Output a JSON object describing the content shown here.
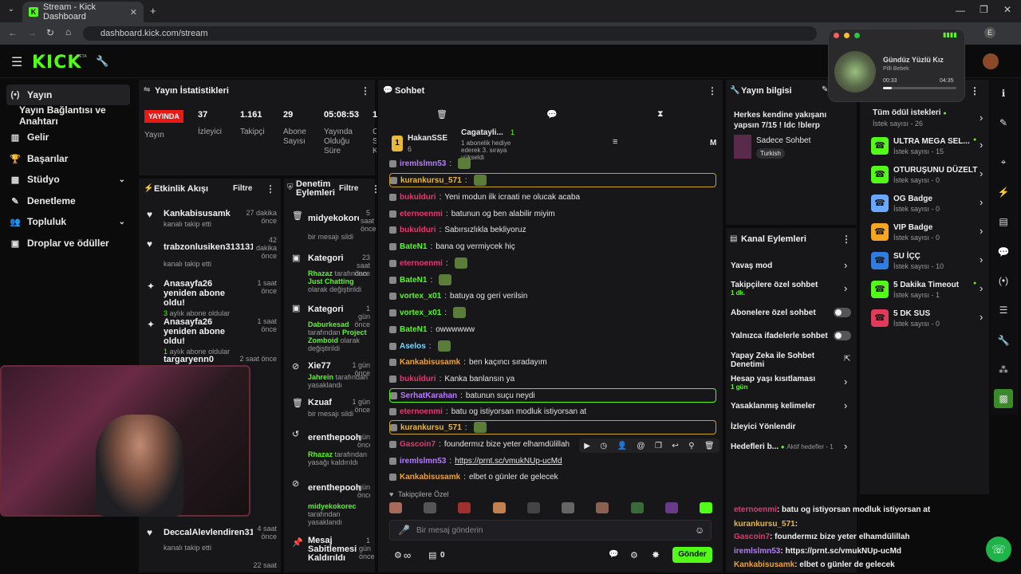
{
  "browser": {
    "tab_title": "Stream - Kick Dashboard",
    "url": "dashboard.kick.com/stream",
    "profile_initial": "E"
  },
  "header": {
    "logo": "KICK",
    "logo_tag": "BETA"
  },
  "sidebar": {
    "items": [
      {
        "label": "Yayın",
        "icon": "(•)"
      },
      {
        "label": "Yayın Bağlantısı ve Anahtarı",
        "icon": ""
      },
      {
        "label": "Gelir",
        "icon": "▥"
      },
      {
        "label": "Başarılar",
        "icon": "🏆"
      },
      {
        "label": "Stüdyo",
        "icon": "▦"
      },
      {
        "label": "Denetleme",
        "icon": "✎"
      },
      {
        "label": "Topluluk",
        "icon": "👥"
      },
      {
        "label": "Droplar ve ödüller",
        "icon": "▣"
      }
    ]
  },
  "stats": {
    "title": "Yayın İstatistikleri",
    "live_badge": "YAYINDA",
    "live_label": "Yayın",
    "items": [
      {
        "value": "37",
        "label": "İzleyici"
      },
      {
        "value": "1.161",
        "label": "Takipçi"
      },
      {
        "value": "29",
        "label": "Abone Sayısı"
      },
      {
        "value": "05:08:53",
        "label": "Yayında Olduğu Süre"
      },
      {
        "value": "1",
        "label": "C S K"
      }
    ]
  },
  "activity": {
    "title": "Etkinlik Akışı",
    "filter": "Filtre",
    "items": [
      {
        "title": "Kankabisusamk",
        "sub": "kanalı takip etti",
        "time": "27 dakika önce"
      },
      {
        "title": "trabzonlusiken313131314",
        "sub": "kanalı takip etti",
        "time": "42 dakika önce"
      },
      {
        "title": "Anasayfa26 yeniden abone oldu!",
        "sub": "aylık abone oldular",
        "subnum": "3",
        "time": "1 saat önce"
      },
      {
        "title": "Anasayfa26 yeniden abone oldu!",
        "sub": "aylık abone oldular",
        "subnum": "1",
        "time": "1 saat önce"
      },
      {
        "title": "targaryenn0",
        "sub": "",
        "time": "2 saat önce"
      },
      {
        "title": "DeccalAlevlendiren3131",
        "sub": "kanalı takip etti",
        "time": "4 saat önce"
      },
      {
        "title": "",
        "sub": "",
        "time": "22 saat"
      }
    ]
  },
  "modlog": {
    "title": "Denetim Eylemleri",
    "filter": "Filtre",
    "items": [
      {
        "title": "midyekokorec",
        "sub": "bir mesajı sildi",
        "time": "5 saat önce"
      },
      {
        "title": "Kategori",
        "sub_user": "Rhazaz",
        "sub": "tarafından",
        "sub_hl": "Just Chatting",
        "sub2": "olarak değiştirildi",
        "time": "23 saat önce"
      },
      {
        "title": "Kategori",
        "sub_user": "Daburkesad",
        "sub": "tarafından",
        "sub_hl": "Project Zomboid",
        "sub2": "olarak değiştirildi",
        "time": "1 gün önce"
      },
      {
        "title": "Xie77",
        "sub_user": "Jahrein",
        "sub": "tarafından yasaklandı",
        "time": "1 gün önce"
      },
      {
        "title": "Kzuaf",
        "sub": "bir mesajı sildi",
        "time": "1 gün önce"
      },
      {
        "title": "erenthepooh",
        "sub_user": "Rhazaz",
        "sub": "tarafından yasağı kaldırıldı",
        "time": "gün önce"
      },
      {
        "title": "erenthepooh",
        "sub_user": "midyekokorec",
        "sub": "tarafından yasaklandı",
        "time": "gün önce"
      },
      {
        "title": "Mesaj Sabitlemesi Kaldırıldı",
        "sub": "",
        "time": "1 gün önce"
      }
    ]
  },
  "chat": {
    "title": "Sohbet",
    "gifter1": {
      "name": "HakanSSE",
      "count": "6"
    },
    "gifter2": {
      "name": "Cagatayli...",
      "count": "1",
      "text": "1 abonelik hediye ederek 3. sıraya yükseldi"
    },
    "messages": [
      {
        "user": "iremlslmn53",
        "text": "",
        "color": "#b57bff"
      },
      {
        "user": "kurankursu_571",
        "text": "",
        "color": "#e8b93c",
        "highlight": "gold"
      },
      {
        "user": "bukulduri",
        "text": "Yeni modun ilk icraati ne olucak acaba",
        "color": "#e3386e"
      },
      {
        "user": "eternoenmi",
        "text": "batunun og ben alabilir miyim",
        "color": "#e3386e"
      },
      {
        "user": "bukulduri",
        "text": "Sabırsızlıkla bekliyoruz",
        "color": "#e3386e"
      },
      {
        "user": "BateN1",
        "text": "bana og vermiycek hiç",
        "color": "#53fc18"
      },
      {
        "user": "eternoenmi",
        "text": "",
        "color": "#e3386e"
      },
      {
        "user": "BateN1",
        "text": "",
        "color": "#53fc18"
      },
      {
        "user": "vortex_x01",
        "text": "batuya og geri verilsin",
        "color": "#53fc18"
      },
      {
        "user": "vortex_x01",
        "text": "",
        "color": "#53fc18"
      },
      {
        "user": "BateN1",
        "text": "owwwwww",
        "color": "#53fc18"
      },
      {
        "user": "Aselos",
        "text": "",
        "color": "#7ad7ff"
      },
      {
        "user": "Kankabisusamk",
        "text": "ben kaçıncı sıradayım",
        "color": "#e8a33c"
      },
      {
        "user": "bukulduri",
        "text": "Kanka banlansın ya",
        "color": "#e3386e"
      },
      {
        "user": "SerhatKarahan",
        "text": "batunun suçu neydi",
        "color": "#b57bff",
        "highlight": "green"
      },
      {
        "user": "eternoenmi",
        "text": "batu og istiyorsan  modluk istiyorsan  at",
        "color": "#e3386e"
      },
      {
        "user": "kurankursu_571",
        "text": "",
        "color": "#e8b93c",
        "highlight": "gold"
      },
      {
        "user": "Gascoin7",
        "text": "foundermız bize yeter elhamdülillah",
        "color": "#e3386e"
      },
      {
        "user": "iremlslmn53",
        "text": "https://prnt.sc/vmukNUp-ucMd",
        "color": "#b57bff"
      },
      {
        "user": "Kankabisusamk",
        "text": "elbet o günler de gelecek",
        "color": "#e8a33c"
      }
    ],
    "followers_only": "Takipçilere Özel",
    "input_placeholder": "Bir mesaj gönderin",
    "count": "0",
    "send": "Gönder",
    "infinity": "∞"
  },
  "streaminfo": {
    "title": "Yayın bilgisi",
    "stream_title": "Herkes kendine yakışanı yapsın 7/15 ! Idc !blerp",
    "category": "Sadece Sohbet",
    "tag": "Turkish"
  },
  "channel_actions": {
    "title": "Kanal Eylemleri",
    "items": [
      {
        "label": "Yavaş mod",
        "type": "chevron"
      },
      {
        "label": "Takipçilere özel sohbet",
        "sub": "1 dk.",
        "type": "chevron"
      },
      {
        "label": "Abonelere özel sohbet",
        "type": "toggle"
      },
      {
        "label": "Yalnızca ifadelerle sohbet",
        "type": "toggle"
      },
      {
        "label": "Yapay Zeka ile Sohbet Denetimi",
        "type": "external"
      },
      {
        "label": "Hesap yaşı kısıtlaması",
        "sub": "1 gün",
        "type": "chevron"
      },
      {
        "label": "Yasaklanmış kelimeler",
        "type": "chevron"
      },
      {
        "label": "İzleyici Yönlendir",
        "type": "none"
      },
      {
        "label": "Hedefleri b...",
        "extra": "Aktif hedefler - 1",
        "type": "chevron"
      }
    ]
  },
  "rewards": {
    "all": "Tüm ödül istekleri",
    "all_count": "İstek sayısı - 26",
    "items": [
      {
        "name": "ULTRA MEGA SEL...",
        "count": "İstek sayısı - 15",
        "color": "#53fc18",
        "dot": true
      },
      {
        "name": "OTURUŞUNU DÜZELT",
        "count": "İstek sayısı - 0",
        "color": "#53fc18",
        "dot": false
      },
      {
        "name": "OG Badge",
        "count": "İstek sayısı - 0",
        "color": "#6aa7ff",
        "dot": false
      },
      {
        "name": "VIP Badge",
        "count": "İstek sayısı - 0",
        "color": "#f5a623",
        "dot": false
      },
      {
        "name": "SU İÇÇ",
        "count": "İstek sayısı - 10",
        "color": "#2f7de1",
        "dot": false
      },
      {
        "name": "5 Dakika Timeout",
        "count": "İstek sayısı - 1",
        "color": "#53fc18",
        "dot": true
      },
      {
        "name": "5 DK SUS",
        "count": "İstek sayısı - 0",
        "color": "#e23a5a",
        "dot": false
      }
    ]
  },
  "music": {
    "title": "Gündüz Yüzlü Kız",
    "artist": "Pilli Bebek",
    "elapsed": "00:33",
    "total": "04:35",
    "progress": 0.12
  },
  "overlay_chat": [
    {
      "user": "eternoenmi",
      "text": "batu og istiyorsan  modluk istiyorsan  at",
      "color": "#e3386e"
    },
    {
      "user": "kurankursu_571",
      "text": "",
      "color": "#e8b93c"
    },
    {
      "user": "Gascoin7",
      "text": "foundermız bize yeter elhamdülillah",
      "color": "#e3386e"
    },
    {
      "user": "iremlslmn53",
      "text": "https://prnt.sc/vmukNUp-ucMd",
      "color": "#b57bff"
    },
    {
      "user": "Kankabisusamk",
      "text": "elbet o günler de gelecek",
      "color": "#e8a33c"
    }
  ],
  "colors": {
    "accent": "#53fc18",
    "live": "#e91916",
    "panel": "#17171a"
  }
}
